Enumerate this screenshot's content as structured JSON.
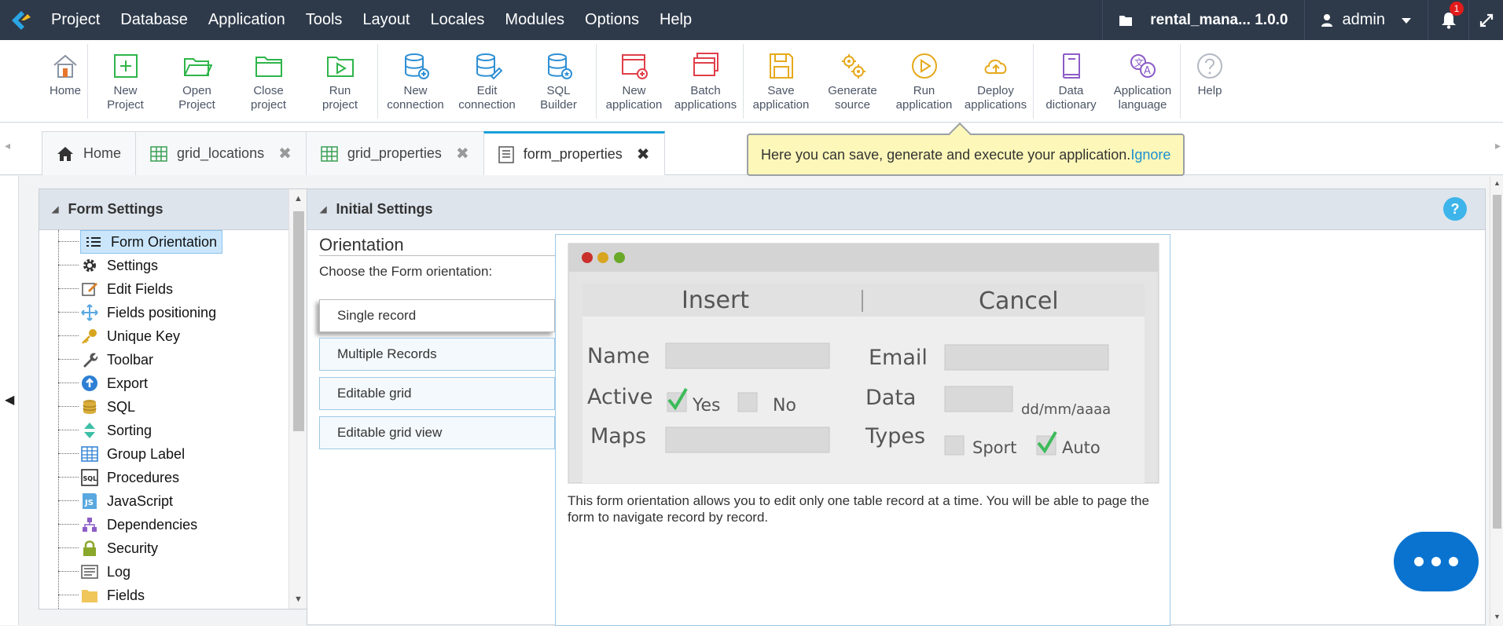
{
  "menubar": {
    "items": [
      "Project",
      "Database",
      "Application",
      "Tools",
      "Layout",
      "Locales",
      "Modules",
      "Options",
      "Help"
    ],
    "project_name": "rental_mana... 1.0.0",
    "user": "admin",
    "notifications": "1"
  },
  "toolbar": {
    "home": "Home",
    "new_project": [
      "New",
      "Project"
    ],
    "open_project": [
      "Open",
      "Project"
    ],
    "close_project": [
      "Close",
      "project"
    ],
    "run_project": [
      "Run",
      "project"
    ],
    "new_connection": [
      "New",
      "connection"
    ],
    "edit_connection": [
      "Edit",
      "connection"
    ],
    "sql_builder": [
      "SQL",
      "Builder"
    ],
    "new_application": [
      "New",
      "application"
    ],
    "batch_applications": [
      "Batch",
      "applications"
    ],
    "save_application": [
      "Save",
      "application"
    ],
    "generate_source": [
      "Generate",
      "source"
    ],
    "run_application": [
      "Run",
      "application"
    ],
    "deploy_applications": [
      "Deploy",
      "applications"
    ],
    "data_dictionary": [
      "Data",
      "dictionary"
    ],
    "application_language": [
      "Application",
      "language"
    ],
    "help": "Help"
  },
  "tabs": {
    "home": "Home",
    "grid_locations": "grid_locations",
    "grid_properties": "grid_properties",
    "form_properties": "form_properties"
  },
  "tooltip": {
    "text": "Here you can save, generate and execute your application.",
    "link": "Ignore"
  },
  "side": {
    "title": "Form Settings",
    "items": [
      "Form Orientation",
      "Settings",
      "Edit Fields",
      "Fields positioning",
      "Unique Key",
      "Toolbar",
      "Export",
      "SQL",
      "Sorting",
      "Group Label",
      "Procedures",
      "JavaScript",
      "Dependencies",
      "Security",
      "Log",
      "Fields"
    ]
  },
  "main": {
    "title": "Initial Settings",
    "orientation_title": "Orientation",
    "orientation_desc": "Choose the Form orientation:",
    "options": [
      "Single record",
      "Multiple Records",
      "Editable grid",
      "Editable grid view"
    ],
    "preview": {
      "insert": "Insert",
      "cancel": "Cancel",
      "name": "Name",
      "email": "Email",
      "active": "Active",
      "yes": "Yes",
      "no": "No",
      "data": "Data",
      "date_fmt": "dd/mm/aaaa",
      "maps": "Maps",
      "types": "Types",
      "sport": "Sport",
      "auto": "Auto"
    },
    "description": "This form orientation allows you to edit only one table record at a time. You will be able to page the form to navigate record by record."
  }
}
